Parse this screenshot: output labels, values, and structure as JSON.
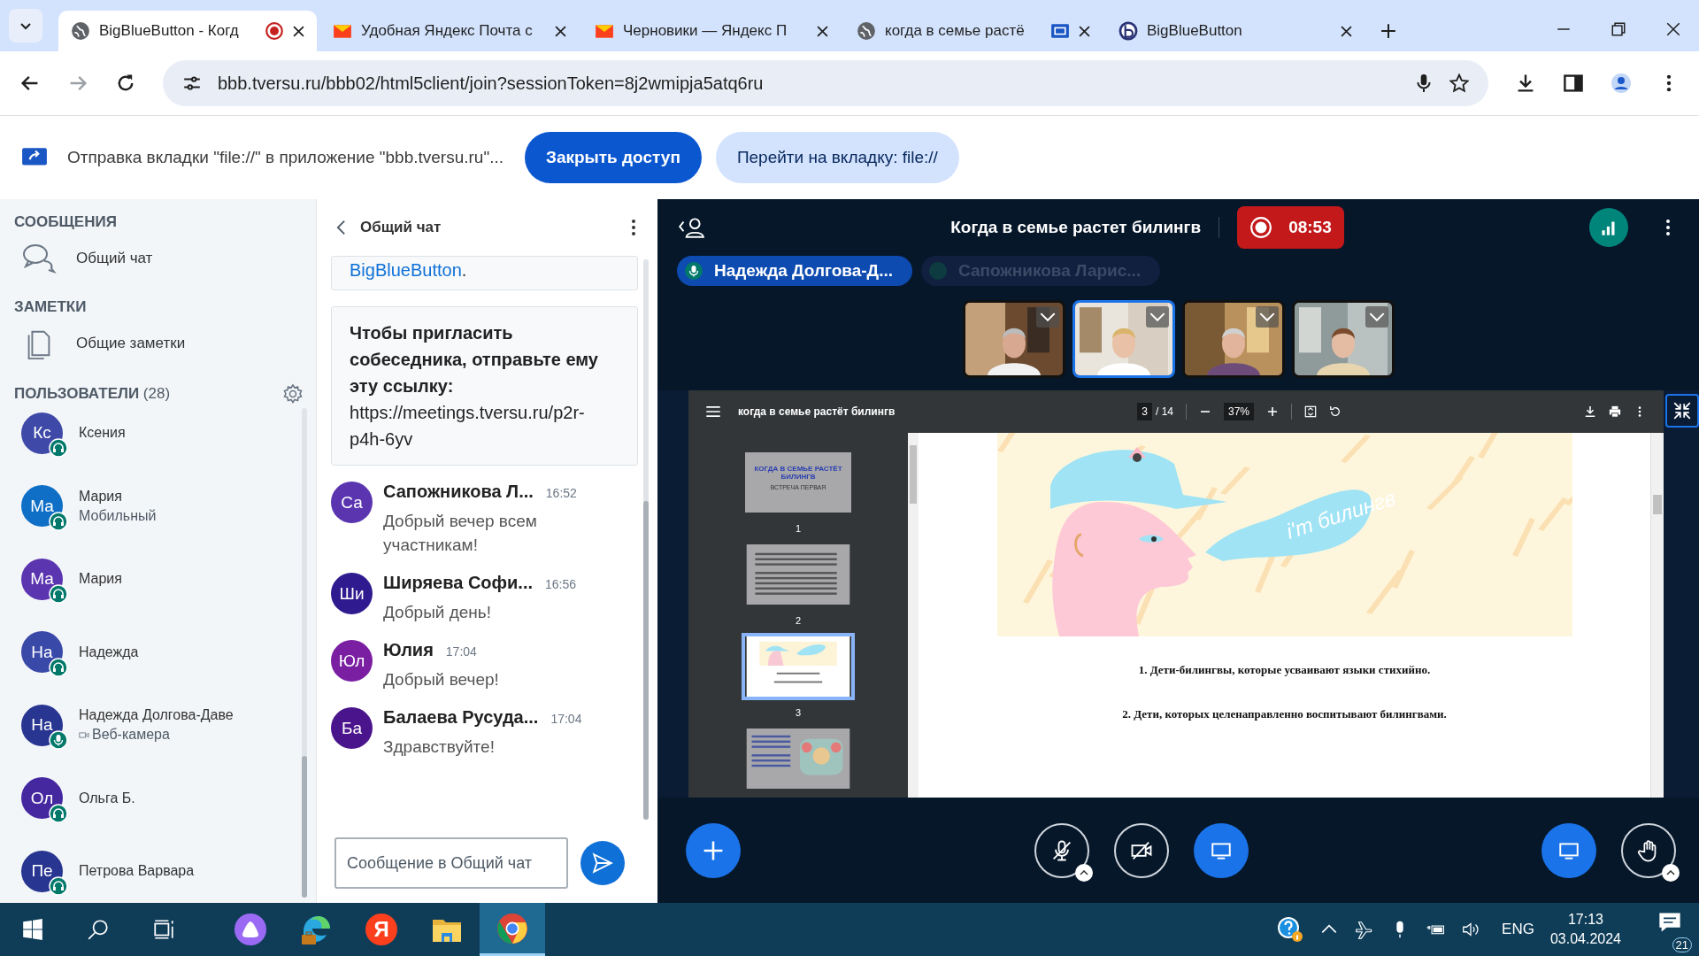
{
  "browser": {
    "tabs": [
      {
        "title": "BigBlueButton - Когд",
        "kind": "globe",
        "recording": true,
        "selected": true
      },
      {
        "title": "Удобная Яндекс Почта с",
        "kind": "mail",
        "selected": false
      },
      {
        "title": "Черновики — Яндекс П",
        "kind": "mail",
        "selected": false
      },
      {
        "title": "когда в семье растё",
        "kind": "globe",
        "sharing": true,
        "selected": false
      },
      {
        "title": "BigBlueButton",
        "kind": "bbb",
        "selected": false
      }
    ],
    "url": "bbb.tversu.ru/bbb02/html5client/join?sessionToken=8j2wmipja5atq6ru"
  },
  "infobar": {
    "message": "Отправка вкладки \"file://\" в приложение \"bbb.tversu.ru\"...",
    "buttons": [
      {
        "label": "Закрыть доступ",
        "kind": "primary"
      },
      {
        "label": "Перейти на вкладку: file://",
        "kind": "secondary"
      }
    ]
  },
  "sidebar": {
    "messages_title": "СООБЩЕНИЯ",
    "chat_item": "Общий чат",
    "notes_title": "ЗАМЕТКИ",
    "notes_item": "Общие заметки",
    "users_title": "ПОЛЬЗОВАТЕЛИ",
    "users_count": "(28)",
    "users": [
      {
        "initials": "Кс",
        "name": "Ксения",
        "color": "#3f4aa8",
        "microphone": false
      },
      {
        "initials": "Ма",
        "name": "Мария",
        "status": {
          "text": "Мобильный"
        },
        "color": "#0f6fc6",
        "microphone": false
      },
      {
        "initials": "Ма",
        "name": "Мария",
        "color": "#5b34b0",
        "microphone": false
      },
      {
        "initials": "На",
        "name": "Надежда",
        "color": "#3949a8",
        "microphone": false
      },
      {
        "initials": "На",
        "name": "Надежда Долгова-Даве",
        "status": {
          "webcam": true,
          "text": "Веб-камера"
        },
        "color": "#283591",
        "microphone": true
      },
      {
        "initials": "Ол",
        "name": "Ольга Б.",
        "color": "#45279f",
        "microphone": false
      },
      {
        "initials": "Пе",
        "name": "Петрова Варвара",
        "color": "#283591",
        "microphone": false
      }
    ]
  },
  "chat": {
    "title": "Общий чат",
    "welcome_link": "BigBlueButton",
    "welcome_after": ".",
    "invite": "Чтобы пригласить собеседника, отправьте ему эту ссылку:",
    "invite_link": "https://meetings.tversu.ru/p2r-p4h-6yv",
    "messages": [
      {
        "initials": "Са",
        "color": "#5b34b0",
        "name": "Сапожникова Л...",
        "time": "16:52",
        "text": "Добрый вечер всем участникам!"
      },
      {
        "initials": "Ши",
        "color": "#2f1b8f",
        "name": "Ширяева Софи...",
        "time": "16:56",
        "text": "Добрый день!"
      },
      {
        "initials": "Юл",
        "color": "#7a1fa2",
        "name": "Юлия",
        "time": "17:04",
        "text": "Добрый вечер!"
      },
      {
        "initials": "Ба",
        "color": "#4a148c",
        "name": "Балаева Русуда...",
        "time": "17:04",
        "text": "Здравствуйте!"
      }
    ],
    "input": {
      "placeholder": "Сообщение в Общий чат"
    }
  },
  "presentation": {
    "title": "Когда в семье растет билингв",
    "recording_time": "08:53",
    "talkers": [
      {
        "name": "Надежда Долгова-Д...",
        "active": true
      },
      {
        "name": "Сапожникова Ларис...",
        "active": false
      }
    ],
    "videos": [
      {
        "selected": false
      },
      {
        "selected": true
      },
      {
        "selected": false
      },
      {
        "selected": false
      }
    ],
    "pdf": {
      "title": "когда в семье растёт билингв",
      "page": "3",
      "total": "/ 14",
      "zoom": "37%",
      "thumbnails": [
        {
          "number": "1",
          "kind": "title",
          "title": "КОГДА В СЕМЬЕ РАСТЁТ БИЛИНГВ",
          "subtitle": "ВСТРЕЧА ПЕРВАЯ",
          "selected": false
        },
        {
          "number": "2",
          "kind": "text",
          "selected": false
        },
        {
          "number": "3",
          "kind": "illustration",
          "selected": true
        },
        {
          "kind": "mixed",
          "selected": false
        }
      ],
      "slide": {
        "bubble": "i'm билингв",
        "lines": [
          "1. Дети-билингвы, которые усваивают языки стихийно.",
          "2. Дети, которых целенаправленно воспитывают билингвами."
        ]
      }
    }
  },
  "taskbar": {
    "apps": [
      {
        "kind": "alice",
        "selected": false
      },
      {
        "kind": "edge",
        "selected": false
      },
      {
        "kind": "yandex",
        "label": "Я",
        "selected": false
      },
      {
        "kind": "explorer",
        "selected": false
      },
      {
        "kind": "chrome",
        "selected": true
      }
    ],
    "language": "ENG",
    "time": "17:13",
    "date": "03.04.2024",
    "notifications": "21"
  }
}
